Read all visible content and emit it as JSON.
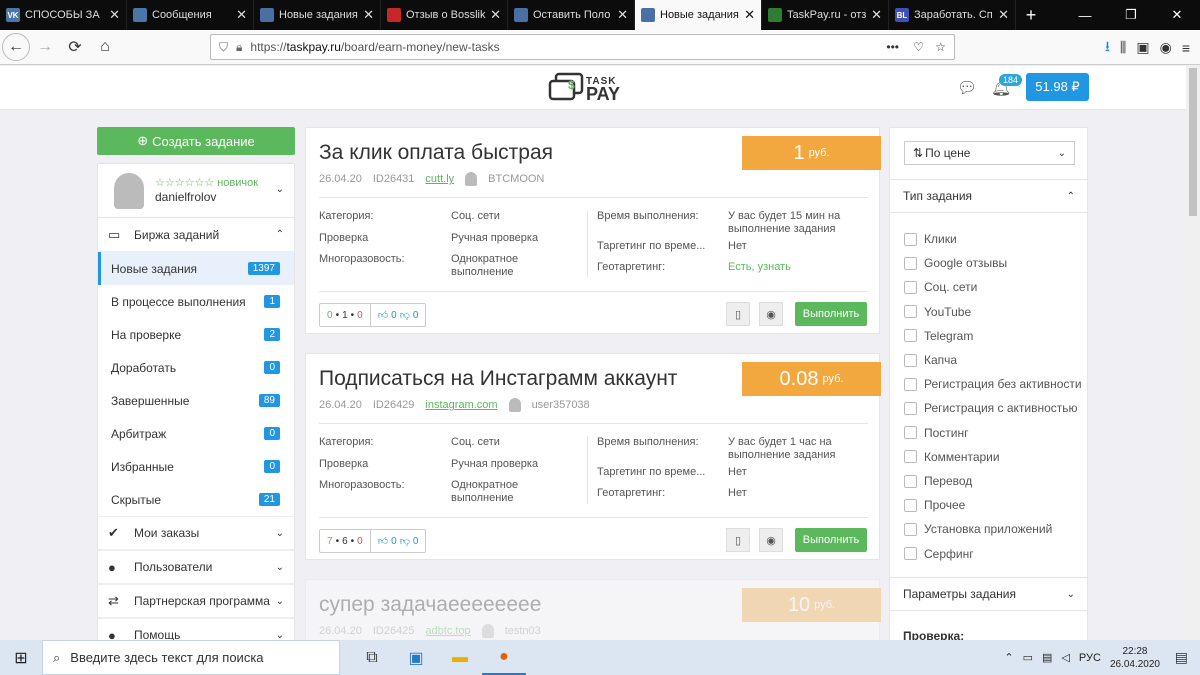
{
  "browser": {
    "tabs": [
      {
        "label": "СПОСОБЫ ЗА",
        "fav": "VK",
        "fav_color": "#4a76a8"
      },
      {
        "label": "Сообщения",
        "fav": "",
        "fav_color": "#4a76a8"
      },
      {
        "label": "Новые задания",
        "fav": "",
        "fav_color": "#4a6fa5"
      },
      {
        "label": "Отзыв о Bosslik",
        "fav": "",
        "fav_color": "#c62828"
      },
      {
        "label": "Оставить Поло",
        "fav": "",
        "fav_color": "#4a6fa5"
      },
      {
        "label": "Новые задания",
        "fav": "",
        "fav_color": "#4a6fa5"
      },
      {
        "label": "TaskPay.ru - отз",
        "fav": "",
        "fav_color": "#2e7d32"
      },
      {
        "label": "Заработать. Сп",
        "fav": "BL",
        "fav_color": "#3f51b5"
      }
    ],
    "url_prefix": "https://",
    "url_domain": "taskpay.ru",
    "url_path": "/board/earn-money/new-tasks",
    "url_more": "•••"
  },
  "header": {
    "logo_top": "TASK",
    "logo_bottom": "PAY",
    "notifications": "184",
    "balance": "51.98 ₽"
  },
  "sidebar": {
    "create_button": "Создать задание",
    "rank": "☆☆☆☆☆☆ новичок",
    "username": "danielfrolov",
    "exchange_header": "Биржа заданий",
    "items": [
      {
        "label": "Новые задания",
        "count": "1397",
        "active": true
      },
      {
        "label": "В процессе выполнения",
        "count": "1"
      },
      {
        "label": "На проверке",
        "count": "2"
      },
      {
        "label": "Доработать",
        "count": "0"
      },
      {
        "label": "Завершенные",
        "count": "89"
      },
      {
        "label": "Арбитраж",
        "count": "0"
      },
      {
        "label": "Избранные",
        "count": "0"
      },
      {
        "label": "Скрытые",
        "count": "21"
      }
    ],
    "sections": [
      {
        "label": "Мои заказы",
        "icon": "✔"
      },
      {
        "label": "Пользователи",
        "icon": "●"
      },
      {
        "label": "Партнерская программа",
        "icon": "⇄"
      },
      {
        "label": "Помощь",
        "icon": "●"
      }
    ]
  },
  "tasks": [
    {
      "title": "За клик оплата быстрая",
      "price": "1",
      "currency": "руб.",
      "date": "26.04.20",
      "id": "ID26431",
      "link": "cutt.ly",
      "user": "BTCMOON",
      "category_label": "Категория:",
      "category": "Соц. сети",
      "check_label": "Проверка",
      "check": "Ручная проверка",
      "reuse_label": "Многоразовость:",
      "reuse": "Однократное выполнение",
      "time_label": "Время выполнения:",
      "time": "У вас будет 15 мин на выполнение задания",
      "targeting_label": "Таргетинг по време...",
      "targeting": "Нет",
      "geo_label": "Геотаргетинг:",
      "geo": "Есть, узнать",
      "geo_link": true,
      "stat_a": "0",
      "stat_b": "1",
      "stat_c": "0",
      "likes": "0",
      "dislikes": "0",
      "do_button": "Выполнить"
    },
    {
      "title": "Подписаться на Инстаграмм аккаунт",
      "price": "0.08",
      "currency": "руб.",
      "date": "26.04.20",
      "id": "ID26429",
      "link": "instagram.com",
      "user": "user357038",
      "category_label": "Категория:",
      "category": "Соц. сети",
      "check_label": "Проверка",
      "check": "Ручная проверка",
      "reuse_label": "Многоразовость:",
      "reuse": "Однократное выполнение",
      "time_label": "Время выполнения:",
      "time": "У вас будет 1 час на выполнение задания",
      "targeting_label": "Таргетинг по време...",
      "targeting": "Нет",
      "geo_label": "Геотаргетинг:",
      "geo": "Нет",
      "geo_link": false,
      "stat_a": "7",
      "stat_b": "6",
      "stat_c": "0",
      "likes": "0",
      "dislikes": "0",
      "do_button": "Выполнить"
    },
    {
      "title": "супер задачаееееееее",
      "price": "10",
      "currency": "руб.",
      "date": "26.04.20",
      "id": "ID26425",
      "link": "adbtc.top",
      "user": "testn03"
    }
  ],
  "filters": {
    "sort": "По цене",
    "type_header": "Тип задания",
    "types": [
      "Клики",
      "Google отзывы",
      "Соц. сети",
      "YouTube",
      "Telegram",
      "Капча",
      "Регистрация без активности",
      "Регистрация с активностью",
      "Постинг",
      "Комментарии",
      "Перевод",
      "Прочее",
      "Установка приложений",
      "Серфинг"
    ],
    "params_header": "Параметры задания",
    "check_label": "Проверка:"
  },
  "taskbar": {
    "search_placeholder": "Введите здесь текст для поиска",
    "lang": "РУС",
    "time": "22:28",
    "date": "26.04.2020"
  }
}
